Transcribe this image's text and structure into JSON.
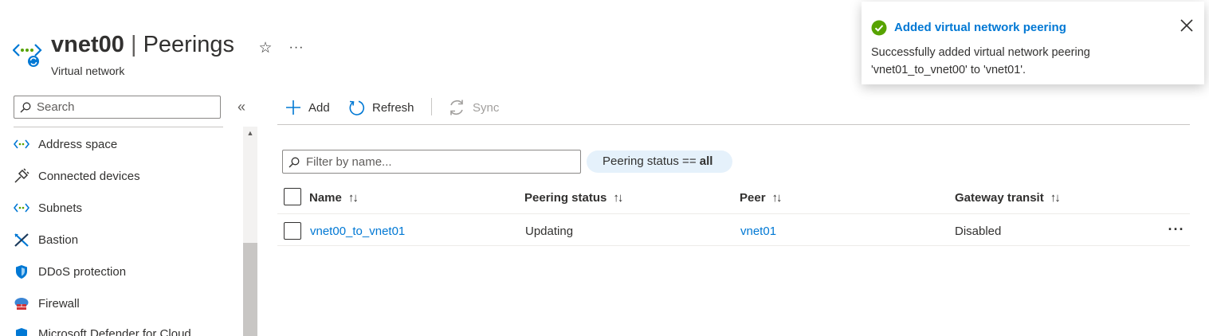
{
  "header": {
    "resource_name": "vnet00",
    "separator": "|",
    "page_name": "Peerings",
    "subtitle": "Virtual network",
    "favorite_icon": "star-icon",
    "more_icon": "ellipsis-icon"
  },
  "sidebar": {
    "search_placeholder": "Search",
    "items": [
      {
        "label": "Address space",
        "icon": "address-space-icon"
      },
      {
        "label": "Connected devices",
        "icon": "plug-icon"
      },
      {
        "label": "Subnets",
        "icon": "subnets-icon"
      },
      {
        "label": "Bastion",
        "icon": "bastion-icon"
      },
      {
        "label": "DDoS protection",
        "icon": "shield-icon"
      },
      {
        "label": "Firewall",
        "icon": "firewall-icon"
      },
      {
        "label": "Microsoft Defender for Cloud",
        "icon": "defender-icon"
      }
    ]
  },
  "toolbar": {
    "add": "Add",
    "refresh": "Refresh",
    "sync": "Sync"
  },
  "filters": {
    "name_placeholder": "Filter by name...",
    "status_prefix": "Peering status ==",
    "status_value": "all"
  },
  "table": {
    "columns": [
      "Name",
      "Peering status",
      "Peer",
      "Gateway transit"
    ],
    "sort_glyph": "↑↓",
    "rows": [
      {
        "name": "vnet00_to_vnet01",
        "status": "Updating",
        "peer": "vnet01",
        "gateway_transit": "Disabled"
      }
    ]
  },
  "notification": {
    "title": "Added virtual network peering",
    "message": "Successfully added virtual network peering 'vnet01_to_vnet00' to 'vnet01'."
  },
  "colors": {
    "accent": "#0078d4",
    "success": "#57a300",
    "pill_bg": "#e5f1fb"
  }
}
